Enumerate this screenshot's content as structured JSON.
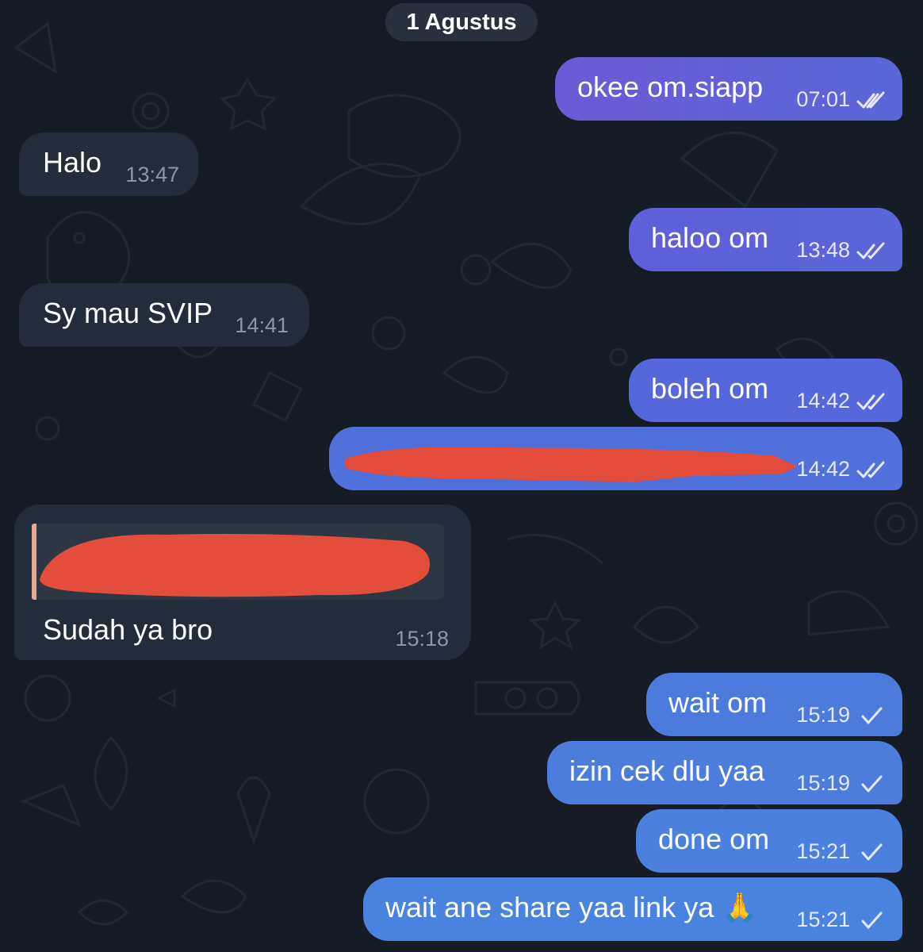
{
  "date_separator": "1 Agustus",
  "colors": {
    "background": "#151c26",
    "incoming_bubble": "#232c3a",
    "outgoing_gradient_start": "#6c5ad6",
    "outgoing_bubble": "#4e78dc",
    "redaction": "#e44c3c"
  },
  "messages": [
    {
      "direction": "out",
      "text": "okee om.siapp",
      "time": "07:01",
      "status": "read",
      "status_icon": "double-check-icon"
    },
    {
      "direction": "in",
      "text": "Halo",
      "time": "13:47"
    },
    {
      "direction": "out",
      "text": "haloo om",
      "time": "13:48",
      "status": "read",
      "status_icon": "double-check-icon"
    },
    {
      "direction": "in",
      "text": "Sy mau SVIP",
      "time": "14:41"
    },
    {
      "direction": "out",
      "text": "boleh om",
      "time": "14:42",
      "status": "read",
      "status_icon": "double-check-icon"
    },
    {
      "direction": "out",
      "text": "",
      "redacted": true,
      "time": "14:42",
      "status": "read",
      "status_icon": "double-check-icon"
    },
    {
      "direction": "in",
      "text": "Sudah ya bro",
      "reply_quote": "redacted",
      "time": "15:18"
    },
    {
      "direction": "out",
      "text": "wait om",
      "time": "15:19",
      "status": "sent",
      "status_icon": "single-check-icon"
    },
    {
      "direction": "out",
      "text": "izin cek dlu yaa",
      "time": "15:19",
      "status": "sent",
      "status_icon": "single-check-icon"
    },
    {
      "direction": "out",
      "text": "done om",
      "time": "15:21",
      "status": "sent",
      "status_icon": "single-check-icon"
    },
    {
      "direction": "out",
      "text": "wait ane share yaa link ya 🙏",
      "time": "15:21",
      "status": "sent",
      "status_icon": "single-check-icon"
    }
  ]
}
